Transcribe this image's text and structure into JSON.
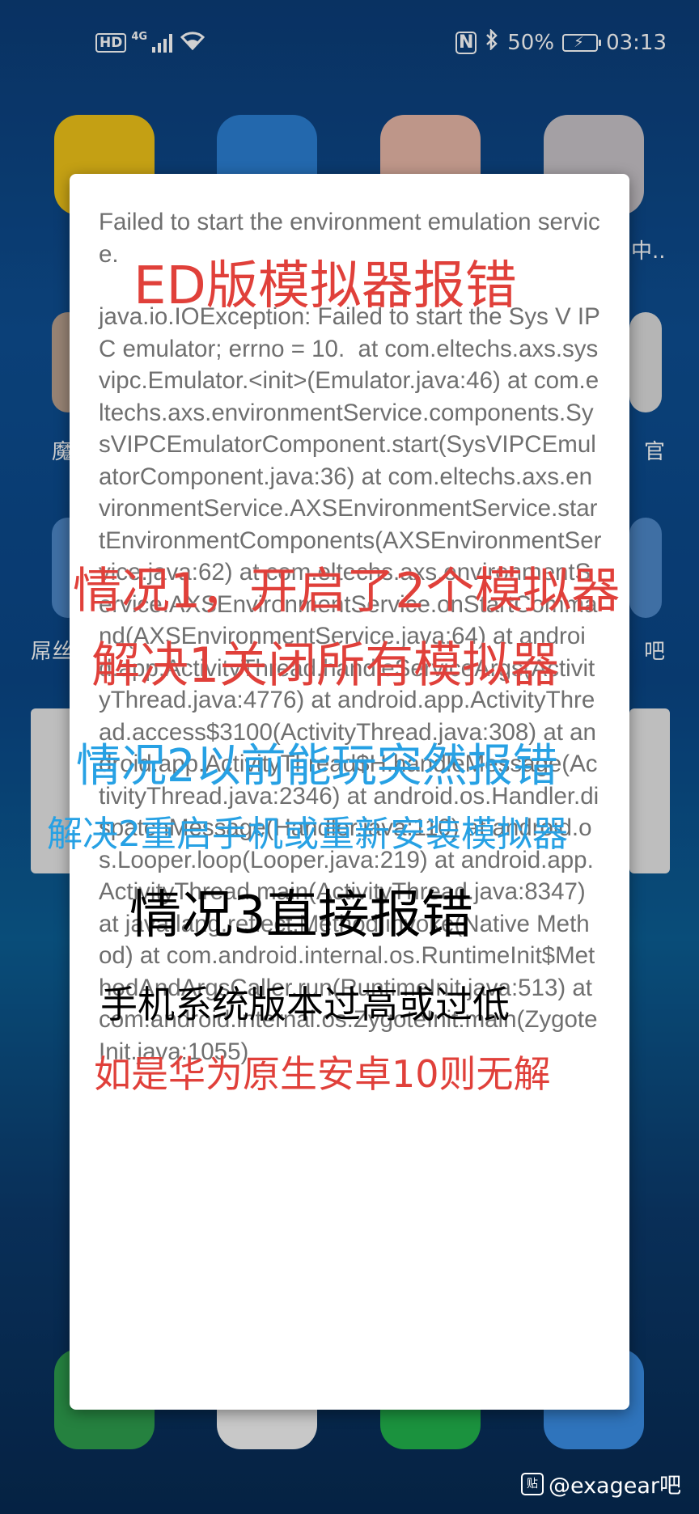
{
  "status_bar": {
    "hd": "HD",
    "network": "4G",
    "battery_percent": "50%",
    "time": "03:13",
    "icons": [
      "hd-icon",
      "signal-icon",
      "wifi-icon",
      "nfc-icon",
      "bluetooth-icon",
      "battery-icon"
    ]
  },
  "home_labels": {
    "right_top": "中..",
    "left_mid": "魔",
    "right_mid": "官",
    "left_low": "屌丝",
    "right_low": "吧"
  },
  "dialog": {
    "title": "Failed to start the environment emulation service.",
    "body": "java.io.IOException: Failed to start the Sys V IPC emulator; errno = 10.  at com.eltechs.axs.sysvipc.Emulator.<init>(Emulator.java:46) at com.eltechs.axs.environmentService.components.SysVIPCEmulatorComponent.start(SysVIPCEmulatorComponent.java:36) at com.eltechs.axs.environmentService.AXSEnvironmentService.startEnvironmentComponents(AXSEnvironmentService.java:62) at com.eltechs.axs.environmentService.AXSEnvironmentService.onStartCommand(AXSEnvironmentService.java:64) at android.app.ActivityThread.handleServiceArgs(ActivityThread.java:4776) at android.app.ActivityThread.access$3100(ActivityThread.java:308) at android.app.ActivityThread$H.handleMessage(ActivityThread.java:2346) at android.os.Handler.dispatchMessage(Handler.java:110) at android.os.Looper.loop(Looper.java:219) at android.app.ActivityThread.main(ActivityThread.java:8347) at java.lang.reflect.Method.invoke(Native Method) at com.android.internal.os.RuntimeInit$MethodAndArgsCaller.run(RuntimeInit.java:513) at com.android.internal.os.ZygoteInit.main(ZygoteInit.java:1055)"
  },
  "annotations": {
    "headline": "ED版模拟器报错",
    "case1": "情况1，开启了2个模拟器",
    "fix1": "解决1关闭所有模拟器",
    "case2": "情况2以前能玩突然报错",
    "fix2": "解决2重启手机或重新安装模拟器",
    "case3": "情况3直接报错",
    "case3_detail": "手机系统版本过高或过低",
    "case3_note": "如是华为原生安卓10则无解"
  },
  "watermark": {
    "icon_text": "贴",
    "text": "@exagear吧"
  },
  "colors": {
    "annotation_red": "#e0403a",
    "annotation_blue": "#27a1e4",
    "dialog_text": "#6f6f6f"
  }
}
